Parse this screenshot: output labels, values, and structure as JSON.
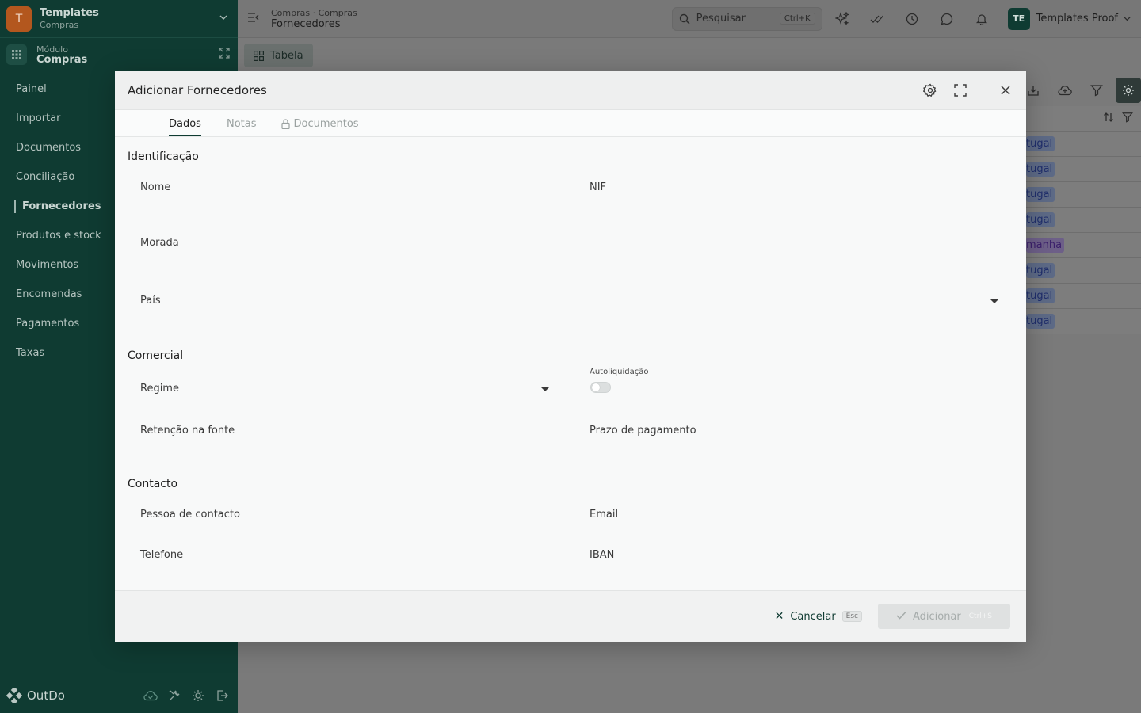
{
  "org": {
    "initial": "T",
    "name": "Templates",
    "subtitle": "Compras"
  },
  "module": {
    "label": "Módulo",
    "name": "Compras"
  },
  "nav": [
    {
      "label": "Painel"
    },
    {
      "label": "Importar"
    },
    {
      "label": "Documentos"
    },
    {
      "label": "Conciliação"
    },
    {
      "label": "Fornecedores",
      "active": true
    },
    {
      "label": "Produtos e stock"
    },
    {
      "label": "Movimentos"
    },
    {
      "label": "Encomendas"
    },
    {
      "label": "Pagamentos"
    },
    {
      "label": "Taxas"
    }
  ],
  "footer": {
    "brand": "OutDo"
  },
  "topbar": {
    "breadcrumb_path": "Compras · Compras",
    "breadcrumb_current": "Fornecedores",
    "search_placeholder": "Pesquisar",
    "search_shortcut": "Ctrl+K",
    "user_initials": "TE",
    "user_name": "Templates Proof"
  },
  "toolbar": {
    "view_tab": "Tabela"
  },
  "background_rows": [
    {
      "country": "tugal",
      "style": "blue"
    },
    {
      "country": "tugal",
      "style": "blue"
    },
    {
      "country": "tugal",
      "style": "blue"
    },
    {
      "country": "tugal",
      "style": "blue"
    },
    {
      "country": "manha",
      "style": "purple"
    },
    {
      "country": "tugal",
      "style": "blue"
    },
    {
      "country": "tugal",
      "style": "blue"
    },
    {
      "country": "tugal",
      "style": "blue"
    }
  ],
  "modal": {
    "title": "Adicionar Fornecedores",
    "tabs": {
      "dados": "Dados",
      "notas": "Notas",
      "documentos": "Documentos"
    },
    "sections": {
      "identificacao": "Identificação",
      "comercial": "Comercial",
      "contacto": "Contacto"
    },
    "fields": {
      "nome": "Nome",
      "nif": "NIF",
      "morada": "Morada",
      "pais": "País",
      "regime": "Regime",
      "autoliquidacao": "Autoliquidação",
      "retencao": "Retenção na fonte",
      "prazo": "Prazo de pagamento",
      "pessoa_contacto": "Pessoa de contacto",
      "email": "Email",
      "telefone": "Telefone",
      "iban": "IBAN"
    },
    "autoliquidacao_enabled": false,
    "cancel_label": "Cancelar",
    "cancel_shortcut": "Esc",
    "add_label": "Adicionar",
    "add_shortcut": "Ctrl+S"
  }
}
